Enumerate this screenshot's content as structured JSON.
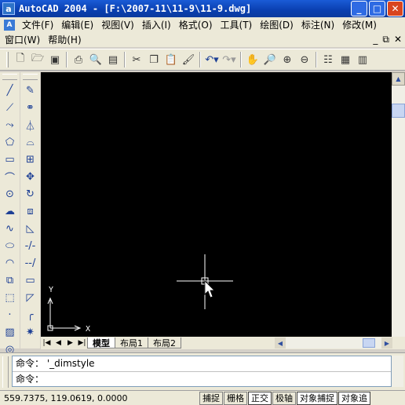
{
  "window": {
    "title": "AutoCAD 2004 - [F:\\2007-11\\11-9\\11-9.dwg]",
    "app_icon": "autocad-icon",
    "buttons": {
      "minimize": "_",
      "maximize": "□",
      "close": "✕"
    }
  },
  "menubar1": {
    "items": [
      "文件(F)",
      "编辑(E)",
      "视图(V)",
      "插入(I)",
      "格式(O)",
      "工具(T)",
      "绘图(D)",
      "标注(N)",
      "修改(M)"
    ]
  },
  "menubar2": {
    "items": [
      "窗口(W)",
      "帮助(H)"
    ],
    "mdi_buttons": {
      "minimize": "_",
      "restore": "⧉",
      "close": "✕"
    }
  },
  "toolbar": {
    "icons": [
      "new-icon",
      "open-icon",
      "save-icon",
      "print-icon",
      "print-preview-icon",
      "publish-icon",
      "cut-icon",
      "copy-icon",
      "paste-icon",
      "match-properties-icon",
      "undo-icon",
      "redo-icon",
      "pan-icon",
      "zoom-realtime-icon",
      "zoom-window-icon",
      "zoom-previous-icon",
      "properties-icon",
      "design-center-icon",
      "tool-palettes-icon"
    ]
  },
  "draw_palette": {
    "tools": [
      "line-icon",
      "construction-line-icon",
      "polyline-icon",
      "polygon-icon",
      "rectangle-icon",
      "arc-icon",
      "circle-icon",
      "revision-cloud-icon",
      "spline-icon",
      "ellipse-icon",
      "ellipse-arc-icon",
      "insert-block-icon",
      "make-block-icon",
      "point-icon",
      "hatch-icon",
      "region-icon"
    ]
  },
  "modify_palette": {
    "tools": [
      "erase-icon",
      "copy-object-icon",
      "mirror-icon",
      "offset-icon",
      "array-icon",
      "move-icon",
      "rotate-icon",
      "scale-icon",
      "stretch-icon",
      "trim-icon",
      "extend-icon",
      "break-icon",
      "chamfer-icon",
      "fillet-icon",
      "explode-icon"
    ]
  },
  "canvas": {
    "background": "#000000",
    "ucs": {
      "x_label": "X",
      "y_label": "Y"
    }
  },
  "tabs": {
    "nav": [
      "|◀",
      "◀",
      "▶",
      "▶|"
    ],
    "items": [
      {
        "label": "模型",
        "active": true
      },
      {
        "label": "布局1",
        "active": false
      },
      {
        "label": "布局2",
        "active": false
      }
    ]
  },
  "command": {
    "line1": "命令： '_dimstyle",
    "line2": "命令："
  },
  "status": {
    "coords": "559.7375, 119.0619, 0.0000",
    "buttons": [
      {
        "label": "捕捉",
        "on": false
      },
      {
        "label": "栅格",
        "on": false
      },
      {
        "label": "正交",
        "on": true
      },
      {
        "label": "极轴",
        "on": false
      },
      {
        "label": "对象捕捉",
        "on": true
      },
      {
        "label": "对象追",
        "on": true
      }
    ]
  }
}
